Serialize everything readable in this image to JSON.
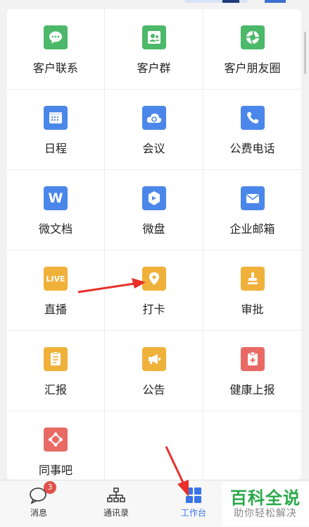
{
  "grid": [
    {
      "label": "客户联系",
      "icon": "wechat-chat-icon",
      "color": "#4cb86a",
      "glyph": ""
    },
    {
      "label": "客户群",
      "icon": "contact-group-icon",
      "color": "#4cb86a",
      "glyph": ""
    },
    {
      "label": "客户朋友圈",
      "icon": "moments-aperture-icon",
      "color": "#4cb86a",
      "glyph": ""
    },
    {
      "label": "日程",
      "icon": "calendar-icon",
      "color": "#4b87ea",
      "glyph": ""
    },
    {
      "label": "会议",
      "icon": "cloud-meeting-icon",
      "color": "#4b87ea",
      "glyph": ""
    },
    {
      "label": "公费电话",
      "icon": "phone-icon",
      "color": "#4b87ea",
      "glyph": ""
    },
    {
      "label": "微文档",
      "icon": "document-w-icon",
      "color": "#4b87ea",
      "glyph": "W"
    },
    {
      "label": "微盘",
      "icon": "cloud-drive-icon",
      "color": "#4b87ea",
      "glyph": ""
    },
    {
      "label": "企业邮箱",
      "icon": "mail-icon",
      "color": "#4b87ea",
      "glyph": ""
    },
    {
      "label": "直播",
      "icon": "live-icon",
      "color": "#f0b13a",
      "glyph": "LIVE"
    },
    {
      "label": "打卡",
      "icon": "location-pin-icon",
      "color": "#f0b13a",
      "glyph": ""
    },
    {
      "label": "审批",
      "icon": "stamp-icon",
      "color": "#f0b13a",
      "glyph": ""
    },
    {
      "label": "汇报",
      "icon": "report-icon",
      "color": "#f0b13a",
      "glyph": ""
    },
    {
      "label": "公告",
      "icon": "megaphone-icon",
      "color": "#f0b13a",
      "glyph": ""
    },
    {
      "label": "健康上报",
      "icon": "health-plus-icon",
      "color": "#e96a64",
      "glyph": ""
    },
    {
      "label": "同事吧",
      "icon": "colleague-network-icon",
      "color": "#e96a64",
      "glyph": ""
    }
  ],
  "tabs": [
    {
      "label": "消息",
      "icon": "message-bubble-icon",
      "badge": "3",
      "active": false
    },
    {
      "label": "通讯录",
      "icon": "org-chart-icon",
      "badge": "",
      "active": false
    },
    {
      "label": "工作台",
      "icon": "workbench-grid-icon",
      "badge": "",
      "active": true
    }
  ],
  "watermark": {
    "title": "百科全说",
    "subtitle": "助你轻松解决"
  },
  "colors": {
    "accent": "#3a74e8",
    "arrow": "#e8302a"
  }
}
